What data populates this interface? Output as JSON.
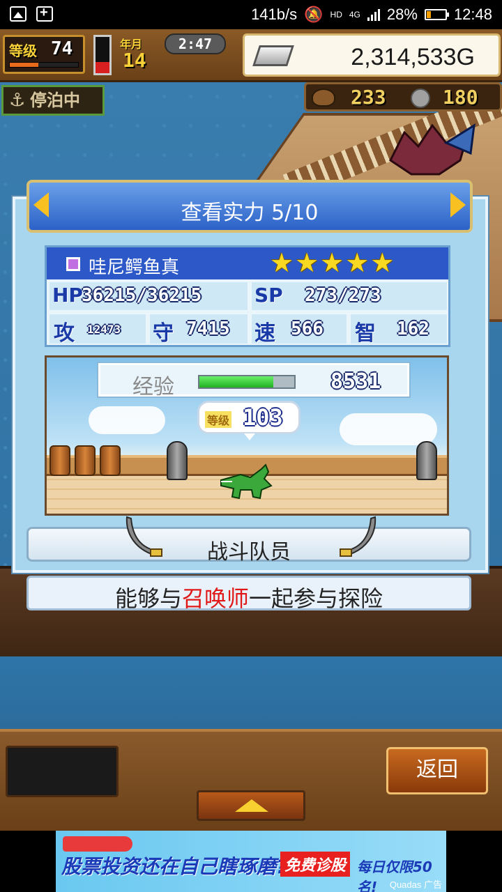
{
  "status_bar": {
    "speed": "141b/s",
    "network": "4G",
    "hd": "HD",
    "battery": "28%",
    "battery_level": 0.28,
    "time": "12:48"
  },
  "hud": {
    "level_label": "等级",
    "level": "74",
    "level_progress": 0.42,
    "red_gauge_level": 0.3,
    "days_label": "年月",
    "days": "14",
    "clock": "2:47",
    "gold": "2,314,533G",
    "moored": "停泊中",
    "resource1": "233",
    "resource2": "180"
  },
  "dialog": {
    "title": "查看实力 5/10",
    "name": "哇尼鳄鱼真",
    "stars": 5,
    "stats": {
      "hp_label": "HP",
      "hp": "36215/36215",
      "sp_label": "SP",
      "sp": "273/273",
      "atk_label": "攻",
      "atk": "12473",
      "def_label": "守",
      "def": "7415",
      "spd_label": "速",
      "spd": "566",
      "int_label": "智",
      "int": "162"
    },
    "exp_label": "经验",
    "exp_progress": 0.78,
    "exp": "8531",
    "unit_level_label": "等级",
    "unit_level": "103",
    "role": "战斗队员",
    "desc_prefix": "能够与",
    "desc_highlight": "召唤师",
    "desc_suffix": "一起参与探险"
  },
  "bottom": {
    "back_label": "返回"
  },
  "ad": {
    "text": "股票投资还在自己瞎琢磨?",
    "badge": "免费诊股",
    "right": "每日仅限50名!",
    "tag": "Quadas 广告"
  },
  "icons": {
    "anchor": "anchor-icon",
    "gold": "silver-bar-icon",
    "resource1": "barrel-icon",
    "resource2": "coin-icon"
  },
  "colors": {
    "title_blue": "#2c62c8",
    "accent_red": "#e01818",
    "star_yellow": "#f8d820"
  }
}
